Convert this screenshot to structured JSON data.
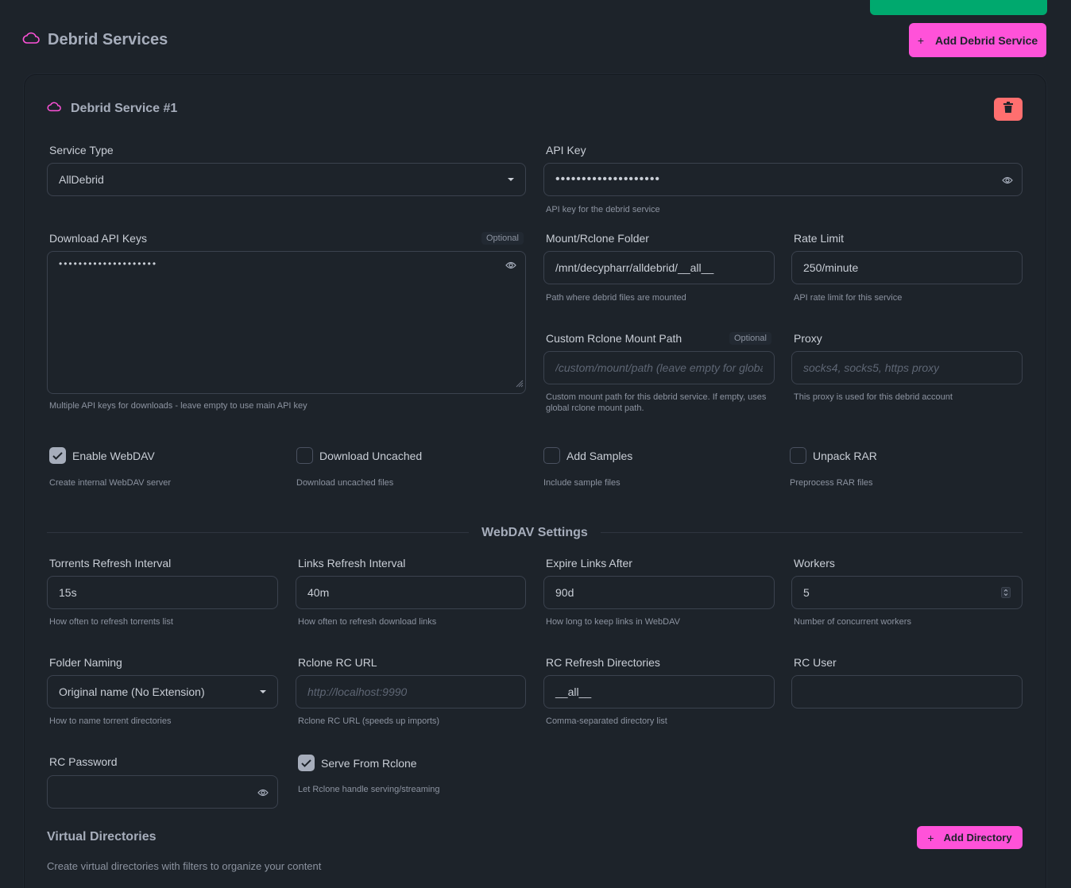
{
  "header": {
    "title": "Debrid Services",
    "add_button": "Add Debrid Service",
    "plus": "+"
  },
  "card": {
    "title": "Debrid Service #1"
  },
  "fields": {
    "service_type": {
      "label": "Service Type",
      "value": "AllDebrid"
    },
    "api_key": {
      "label": "API Key",
      "value": "••••••••••••••••••••",
      "help": "API key for the debrid service"
    },
    "download_api_keys": {
      "label": "Download API Keys",
      "badge": "Optional",
      "value": "••••••••••••••••••••",
      "help": "Multiple API keys for downloads - leave empty to use main API key"
    },
    "mount_folder": {
      "label": "Mount/Rclone Folder",
      "value": "/mnt/decypharr/alldebrid/__all__",
      "help": "Path where debrid files are mounted"
    },
    "rate_limit": {
      "label": "Rate Limit",
      "value": "250/minute",
      "help": "API rate limit for this service"
    },
    "custom_mount": {
      "label": "Custom Rclone Mount Path",
      "badge": "Optional",
      "placeholder": "/custom/mount/path (leave empty for global)",
      "help": "Custom mount path for this debrid service. If empty, uses global rclone mount path."
    },
    "proxy": {
      "label": "Proxy",
      "placeholder": "socks4, socks5, https proxy",
      "help": "This proxy is used for this debrid account"
    }
  },
  "checkboxes": [
    {
      "label": "Enable WebDAV",
      "help": "Create internal WebDAV server",
      "checked": true
    },
    {
      "label": "Download Uncached",
      "help": "Download uncached files",
      "checked": false
    },
    {
      "label": "Add Samples",
      "help": "Include sample files",
      "checked": false
    },
    {
      "label": "Unpack RAR",
      "help": "Preprocess RAR files",
      "checked": false
    }
  ],
  "webdav": {
    "title": "WebDAV Settings",
    "torrents_refresh": {
      "label": "Torrents Refresh Interval",
      "value": "15s",
      "help": "How often to refresh torrents list"
    },
    "links_refresh": {
      "label": "Links Refresh Interval",
      "value": "40m",
      "help": "How often to refresh download links"
    },
    "expire_links": {
      "label": "Expire Links After",
      "value": "90d",
      "help": "How long to keep links in WebDAV"
    },
    "workers": {
      "label": "Workers",
      "value": "5",
      "help": "Number of concurrent workers"
    },
    "folder_naming": {
      "label": "Folder Naming",
      "value": "Original name (No Extension)",
      "help": "How to name torrent directories"
    },
    "rclone_rc_url": {
      "label": "Rclone RC URL",
      "placeholder": "http://localhost:9990",
      "help": "Rclone RC URL (speeds up imports)"
    },
    "rc_refresh_dirs": {
      "label": "RC Refresh Directories",
      "value": "__all__",
      "help": "Comma-separated directory list"
    },
    "rc_user": {
      "label": "RC User",
      "value": ""
    },
    "rc_password": {
      "label": "RC Password",
      "value": ""
    },
    "serve_from_rclone": {
      "label": "Serve From Rclone",
      "help": "Let Rclone handle serving/streaming",
      "checked": true
    }
  },
  "virtual_dirs": {
    "title": "Virtual Directories",
    "add_button": "Add Directory",
    "description": "Create virtual directories with filters to organize your content"
  },
  "colors": {
    "background": "#1d232a",
    "accent_pink": "#ff52d9",
    "success_green": "#00a96e",
    "danger_red": "#ff6f6f",
    "text": "#a6adbb"
  }
}
